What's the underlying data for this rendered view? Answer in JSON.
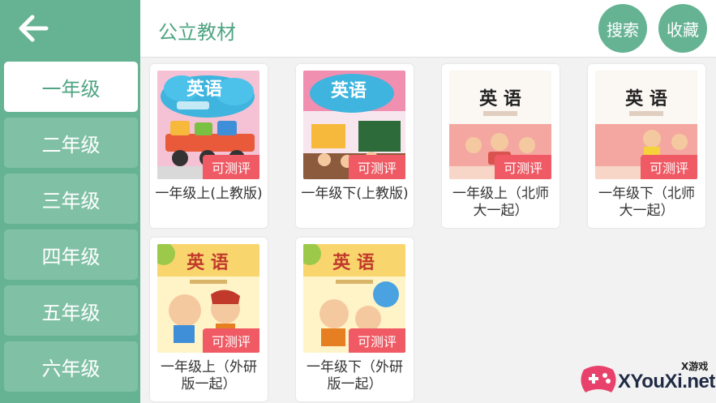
{
  "header": {
    "title": "公立教材",
    "search_label": "搜索",
    "favorites_label": "收藏"
  },
  "sidebar": {
    "back_icon": "arrow-left-icon",
    "grades": [
      "一年级",
      "二年级",
      "三年级",
      "四年级",
      "五年级",
      "六年级"
    ],
    "active_grade": "一年级"
  },
  "books": [
    {
      "title": "一年级上(上教版)",
      "badge": "可测评",
      "cover_text": "英语"
    },
    {
      "title": "一年级下(上教版)",
      "badge": "可测评",
      "cover_text": "英语"
    },
    {
      "title": "一年级上（北师大一起）",
      "badge": "可测评",
      "cover_text": "英 语"
    },
    {
      "title": "一年级下（北师大一起）",
      "badge": "可测评",
      "cover_text": "英 语"
    },
    {
      "title": "一年级上（外研版一起）",
      "badge": "可测评",
      "cover_text": "英 语"
    },
    {
      "title": "一年级下（外研版一起）",
      "badge": "可测评",
      "cover_text": "英 语"
    }
  ],
  "watermark": {
    "small_text": "X游戏",
    "big_text": "XYouXi.net"
  },
  "colors": {
    "sidebar_bg": "#66b394",
    "grade_item_bg": "#80c1a5",
    "accent": "#4fa583",
    "badge_bg": "#ef5a64"
  }
}
